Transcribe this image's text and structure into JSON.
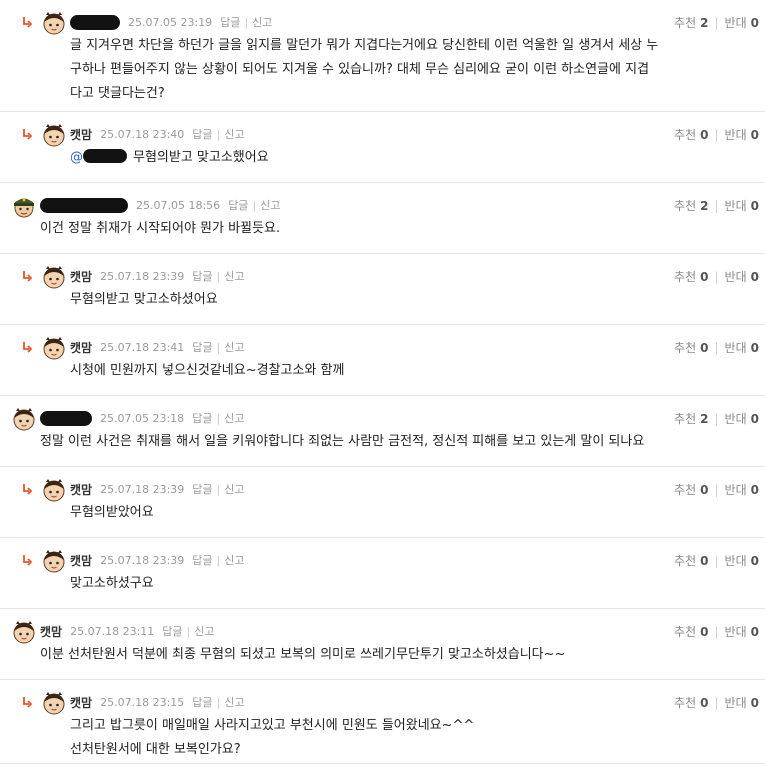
{
  "labels": {
    "reply": "답글",
    "report": "신고",
    "recommend": "추천",
    "oppose": "반대"
  },
  "comments": [
    {
      "type": "reply",
      "avatar": "cat-avatar",
      "author": "",
      "redacted": true,
      "date": "25.07.05 23:19",
      "up": "2",
      "down": "0",
      "text": "글 지겨우면 차단을 하던가 글을 읽지를 말던가 뭐가 지겹다는거에요 당신한테 이런 억울한 일 생겨서 세상 누\n구하나 편들어주지 않는 상황이 되어도 지겨울 수 있습니까? 대체 무슨 심리에요 굳이 이런 하소연글에 지겹\n다고 댓글다는건?"
    },
    {
      "type": "reply",
      "avatar": "cat-avatar",
      "author": "캣맘",
      "date": "25.07.18 23:40",
      "up": "0",
      "down": "0",
      "mention": "@",
      "text": "무혐의받고 맞고소했어요"
    },
    {
      "type": "top",
      "avatar": "military-avatar",
      "author": "",
      "redacted": true,
      "date": "25.07.05 18:56",
      "up": "2",
      "down": "0",
      "text": "이건 정말 취재가 시작되어야 뭔가 바뀔듯요."
    },
    {
      "type": "reply",
      "avatar": "cat-avatar",
      "author": "캣맘",
      "date": "25.07.18 23:39",
      "up": "0",
      "down": "0",
      "text": "무혐의받고 맞고소하셨어요"
    },
    {
      "type": "reply",
      "avatar": "cat-avatar",
      "author": "캣맘",
      "date": "25.07.18 23:41",
      "up": "0",
      "down": "0",
      "text": "시청에 민원까지 넣으신것같네요~경찰고소와 함께"
    },
    {
      "type": "top",
      "avatar": "cat-avatar",
      "author": "",
      "redacted": true,
      "date": "25.07.05 23:18",
      "up": "2",
      "down": "0",
      "text": "정말 이런 사건은 취재를 해서 일을 키워야합니다 죄없는 사람만 금전적, 정신적 피해를 보고 있는게 말이 되나요"
    },
    {
      "type": "reply",
      "avatar": "cat-avatar",
      "author": "캣맘",
      "date": "25.07.18 23:39",
      "up": "0",
      "down": "0",
      "text": "무혐의받았어요"
    },
    {
      "type": "reply",
      "avatar": "cat-avatar",
      "author": "캣맘",
      "date": "25.07.18 23:39",
      "up": "0",
      "down": "0",
      "text": "맞고소하셨구요"
    },
    {
      "type": "top",
      "avatar": "cat-avatar",
      "author": "캣맘",
      "date": "25.07.18 23:11",
      "up": "0",
      "down": "0",
      "text": "이분 선처탄원서 덕분에 최종 무혐의 되셨고 보복의 의미로 쓰레기무단투기 맞고소하셨습니다~~"
    },
    {
      "type": "reply",
      "avatar": "cat-avatar",
      "author": "캣맘",
      "date": "25.07.18 23:15",
      "up": "0",
      "down": "0",
      "text": "그리고 밥그릇이 매일매일 사라지고있고 부천시에 민원도 들어왔네요~^^\n선처탄원서에 대한 보복인가요?"
    }
  ]
}
